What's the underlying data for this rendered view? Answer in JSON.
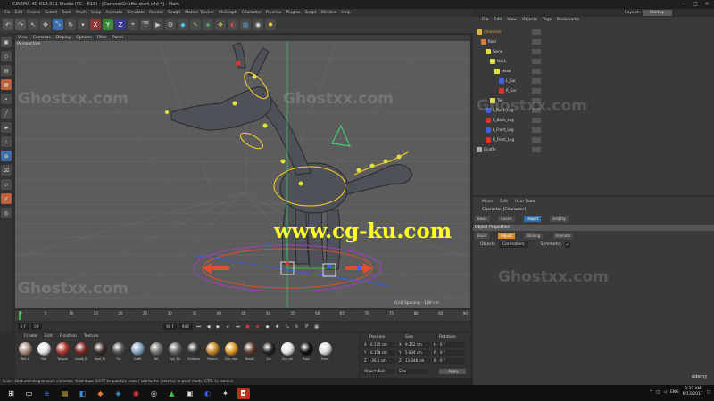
{
  "title": "CINEMA 4D R18.011 Studio (RC - R18) - [CartoonGiraffe_start.c4d *] - Main",
  "menubar": [
    "File",
    "Edit",
    "Create",
    "Select",
    "Tools",
    "Mesh",
    "Snap",
    "Animate",
    "Simulate",
    "Render",
    "Sculpt",
    "Motion Tracker",
    "MoGraph",
    "Character",
    "Pipeline",
    "Plugins",
    "Script",
    "Window",
    "Help"
  ],
  "layout": {
    "label": "Layout:",
    "value": "Startup"
  },
  "viewport": {
    "menu": [
      "View",
      "Cameras",
      "Display",
      "Options",
      "Filter",
      "Panel"
    ],
    "label": "Perspective",
    "grid_spacing": "Grid Spacing : 100 cm"
  },
  "timeline": {
    "ticks": [
      "0",
      "5",
      "10",
      "15",
      "20",
      "25",
      "30",
      "35",
      "40",
      "45",
      "50",
      "55",
      "60",
      "65",
      "70",
      "75",
      "80",
      "85",
      "90"
    ],
    "current_frame": "0 F",
    "start": "0 F",
    "end": "90 F",
    "end2": "90 F"
  },
  "materials": {
    "menu": [
      "Create",
      "Edit",
      "Function",
      "Texture"
    ],
    "items": [
      {
        "name": "Mat.1",
        "color": "#a98f83"
      },
      {
        "name": "Mat",
        "color": "#e8e8e8"
      },
      {
        "name": "Tongue",
        "color": "#b33b2e"
      },
      {
        "name": "Inside_M",
        "color": "#7b2a22"
      },
      {
        "name": "Hoof_Mi",
        "color": "#3b2e28"
      },
      {
        "name": "Fur",
        "color": "#555555"
      },
      {
        "name": "Outfit",
        "color": "#8aa6c8"
      },
      {
        "name": "Pat",
        "color": "#777777"
      },
      {
        "name": "Eye_Tail",
        "color": "#696969"
      },
      {
        "name": "Eyebrow",
        "color": "#3a3a3a"
      },
      {
        "name": "Pattern",
        "color": "#c98a2a"
      },
      {
        "name": "Eye_mat",
        "color": "#e09a2a"
      },
      {
        "name": "Nostril",
        "color": "#5a3a2a"
      },
      {
        "name": "Iris",
        "color": "#222222"
      },
      {
        "name": "Eye_wh",
        "color": "#e6e6e6"
      },
      {
        "name": "Pupil",
        "color": "#111111"
      },
      {
        "name": "Shine",
        "color": "#dddddd"
      }
    ]
  },
  "coords": {
    "headers": [
      "Position",
      "Size",
      "Rotation"
    ],
    "rows": [
      {
        "axis": "X",
        "pos": "0.135 cm",
        "size": "9.352 cm",
        "rot_axis": "H",
        "rot": "0 °"
      },
      {
        "axis": "Y",
        "pos": "0.158 cm",
        "size": "5.634 cm",
        "rot_axis": "P",
        "rot": "0 °"
      },
      {
        "axis": "Z",
        "pos": "-26.6 cm",
        "size": "13.348 cm",
        "rot_axis": "B",
        "rot": "0 °"
      }
    ],
    "mode": "Object (Rel)",
    "size_mode": "Size",
    "apply": "Apply"
  },
  "status": "Scale: Click and drag to scale elements. Hold down SHIFT to quantize scale / add to the selection in point mode, CTRL to remove.",
  "objects_panel": {
    "menu": [
      "File",
      "Edit",
      "View",
      "Objects",
      "Tags",
      "Bookmarks"
    ],
    "items": [
      {
        "name": "Character",
        "indent": 0,
        "color": "#e0b040",
        "active": true
      },
      {
        "name": "Root",
        "indent": 1,
        "color": "#d08040"
      },
      {
        "name": "Spine",
        "indent": 2,
        "color": "#e0e040"
      },
      {
        "name": "Neck",
        "indent": 3,
        "color": "#e0e040"
      },
      {
        "name": "Head",
        "indent": 4,
        "color": "#e0e040"
      },
      {
        "name": "L_Ear",
        "indent": 5,
        "color": "#4060e0"
      },
      {
        "name": "R_Ear",
        "indent": 5,
        "color": "#e03030"
      },
      {
        "name": "Tail",
        "indent": 3,
        "color": "#e0e040"
      },
      {
        "name": "L_Back_Leg",
        "indent": 2,
        "color": "#4060e0"
      },
      {
        "name": "R_Back_Leg",
        "indent": 2,
        "color": "#e03030"
      },
      {
        "name": "L_Front_Leg",
        "indent": 2,
        "color": "#4060e0"
      },
      {
        "name": "R_Front_Leg",
        "indent": 2,
        "color": "#e03030"
      },
      {
        "name": "Giraffe",
        "indent": 0,
        "color": "#aaaaaa"
      }
    ]
  },
  "attributes": {
    "menu": [
      "Mode",
      "Edit",
      "User Data"
    ],
    "title": "Character [Character]",
    "tabs": [
      "Basic",
      "Coord.",
      "Object",
      "Display"
    ],
    "active_tab": "Object",
    "section": "Object Properties",
    "subtabs": [
      "Build",
      "Adjust",
      "Binding",
      "Animate"
    ],
    "active_subtab": "Adjust",
    "objects_label": "Objects",
    "objects_value": "Controllers",
    "symmetry_label": "Symmetry",
    "symmetry_checked": true
  },
  "watermarks": {
    "ghost": "Ghostxx.com",
    "cgku": "www.cg-ku.com"
  },
  "taskbar": {
    "lang": "ENG",
    "time": "3:37 AM",
    "date": "6/13/2017",
    "udemy": "udemy"
  }
}
